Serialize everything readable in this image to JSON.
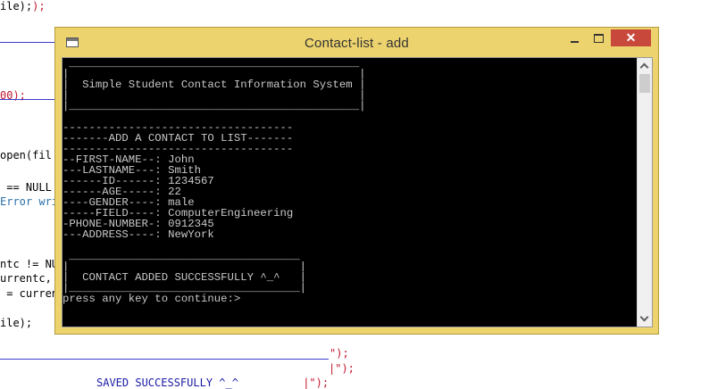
{
  "editor": {
    "lines": [
      {
        "segments": [
          {
            "t": "ile);",
            "c": ""
          }
        ]
      },
      {
        "segments": [
          {
            "t": "00);",
            "c": "red"
          }
        ]
      },
      {
        "segments": [
          {
            "t": "open(fil",
            "c": ""
          }
        ]
      },
      {
        "segments": [
          {
            "t": " == NULL",
            "c": ""
          }
        ]
      },
      {
        "segments": [
          {
            "t": "Error wri",
            "c": "teal"
          }
        ]
      },
      {
        "segments": [
          {
            "t": "ntc != NU",
            "c": ""
          }
        ]
      },
      {
        "segments": [
          {
            "t": "urrentc,",
            "c": ""
          }
        ]
      },
      {
        "segments": [
          {
            "t": " = curren",
            "c": ""
          }
        ]
      },
      {
        "segments": [
          {
            "t": "ile);",
            "c": ""
          }
        ]
      },
      {
        "segments": [
          {
            "t": "\");",
            "c": "red"
          }
        ]
      },
      {
        "segments": [
          {
            "t": "|\");",
            "c": "red"
          }
        ]
      },
      {
        "segments": [
          {
            "t": "SAVED SUCCESSFULLY ^_^",
            "c": "blue"
          },
          {
            "t": "          |\");",
            "c": "red"
          }
        ]
      }
    ]
  },
  "window": {
    "title": "Contact-list - add",
    "close_glyph": "✕"
  },
  "console": {
    "lines": [
      " ____________________________________________",
      "|                                            |",
      "|  Simple Student Contact Information System |",
      "|                                            |",
      "|____________________________________________|",
      "-----------------------------------",
      "-------ADD A CONTACT TO LIST-------",
      "-----------------------------------",
      "--FIRST-NAME--: John",
      "---LASTNAME---: Smith",
      "------ID------: 1234567",
      "------AGE-----: 22",
      "----GENDER----: male",
      "-----FIELD----: ComputerEngineering",
      "-PHONE-NUMBER-: 0912345",
      "---ADDRESS----: NewYork",
      " ___________________________________",
      "|                                   |",
      "|  CONTACT ADDED SUCCESSFULLY ^_^   |",
      "|___________________________________|",
      "press any key to continue:>"
    ]
  }
}
